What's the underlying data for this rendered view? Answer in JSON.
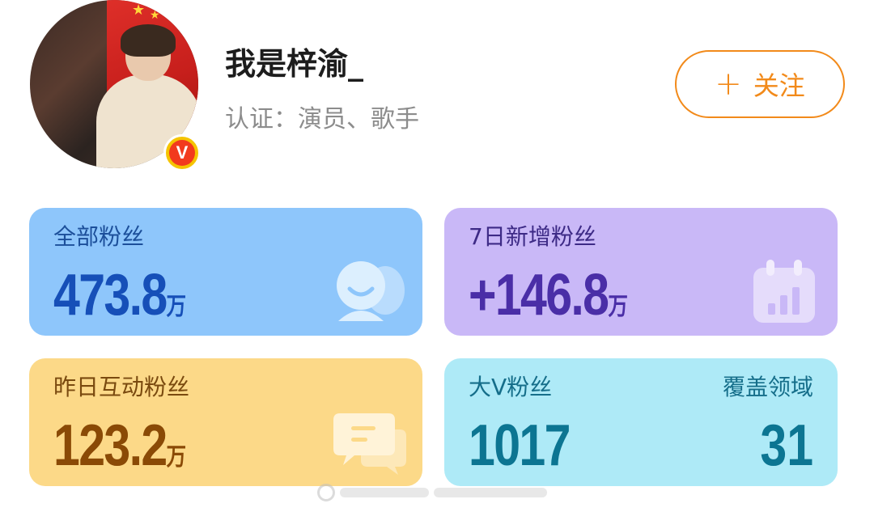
{
  "profile": {
    "name": "我是梓渝_",
    "verification": "认证：演员、歌手",
    "verified_badge": "V",
    "follow_label": "关注",
    "follow_plus": "+"
  },
  "stats": {
    "total_fans": {
      "label": "全部粉丝",
      "value": "473.8",
      "unit": "万"
    },
    "new_fans_7d": {
      "label": "7日新增粉丝",
      "value": "+146.8",
      "unit": "万"
    },
    "interactive_fans_yesterday": {
      "label": "昨日互动粉丝",
      "value": "123.2",
      "unit": "万"
    },
    "big_v_fans": {
      "label": "大V粉丝",
      "value": "1017"
    },
    "coverage_fields": {
      "label": "覆盖领域",
      "value": "31"
    }
  },
  "colors": {
    "accent_orange": "#f28a1a",
    "card_blue": "#8ec6fb",
    "card_purple": "#c9b8f7",
    "card_yellow": "#fcd988",
    "card_cyan": "#aeeaf7"
  },
  "icons": {
    "total_fans": "smiley-people-icon",
    "new_fans_7d": "calendar-chart-icon",
    "interactive_fans": "chat-bubbles-icon"
  }
}
